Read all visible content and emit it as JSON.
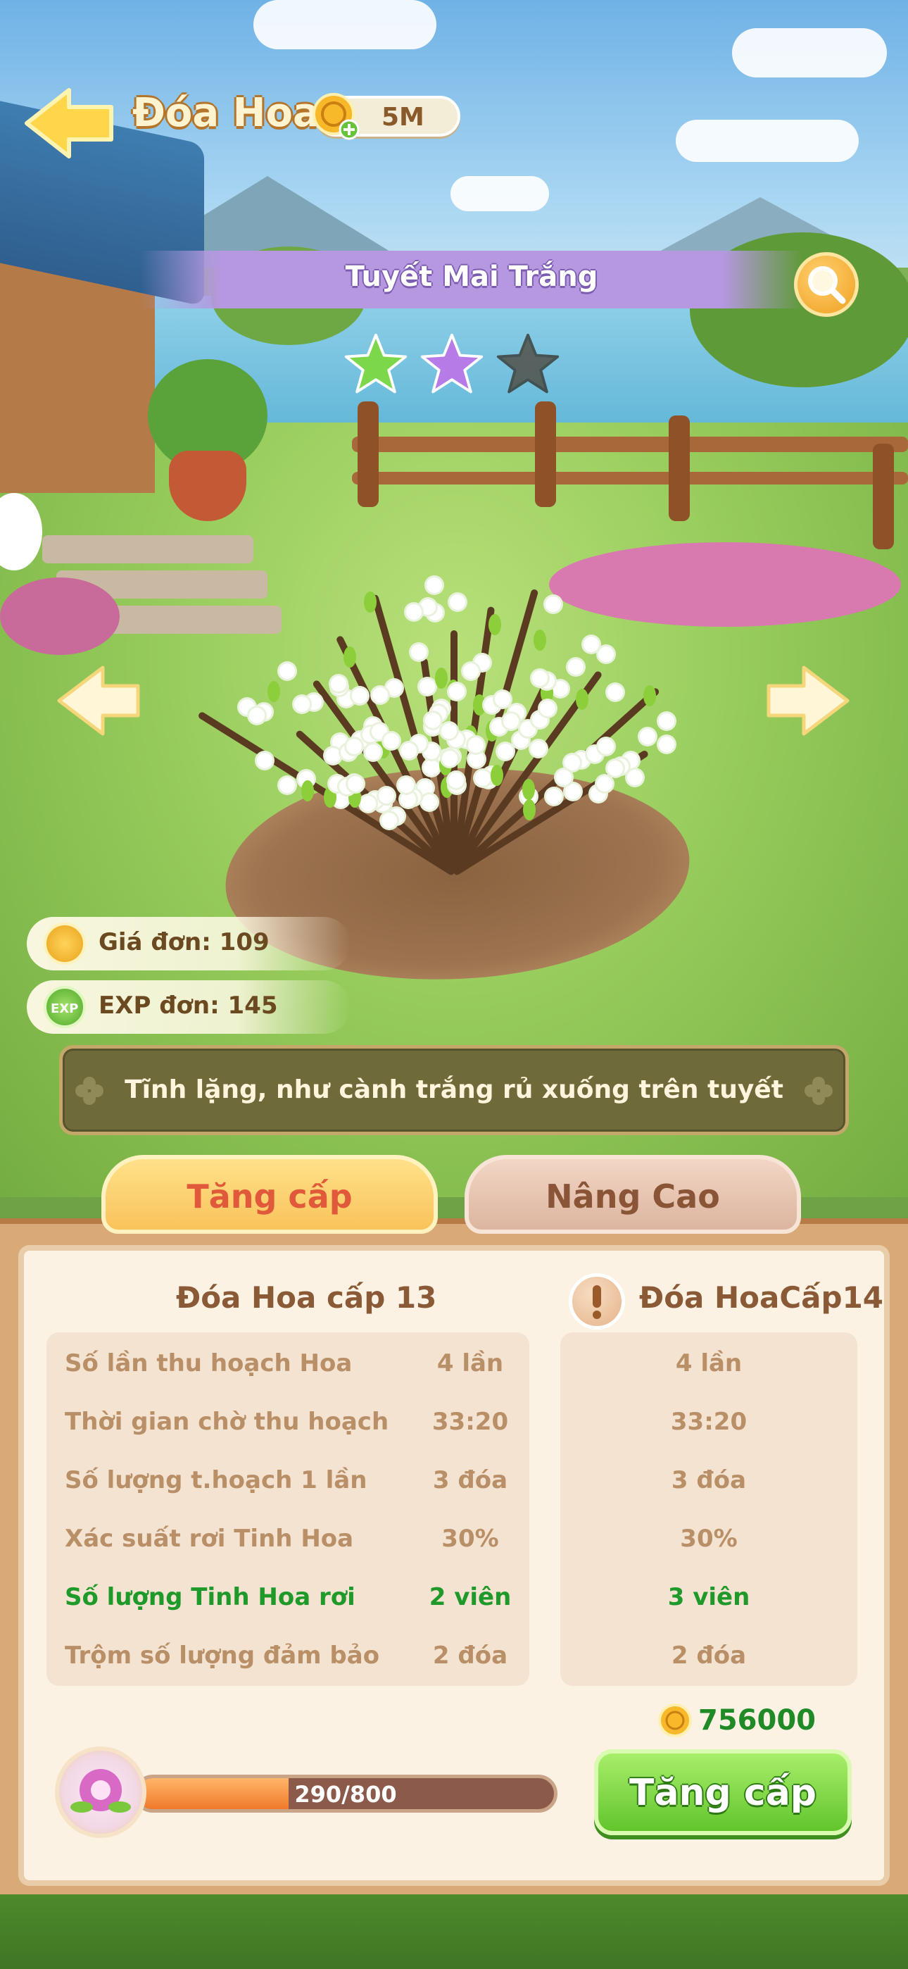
{
  "header": {
    "title": "Đóa Hoa",
    "coins": "5M"
  },
  "flower": {
    "name": "Tuyết Mai Trắng",
    "stars_filled": 2,
    "stars_total": 3,
    "star_colors": [
      "#7cd84a",
      "#b77be8",
      "#4a3a2a"
    ],
    "description": "Tĩnh lặng, như cành trắng rủ xuống trên tuyết"
  },
  "stats": {
    "price": "Giá đơn: 109",
    "exp": "EXP đơn: 145",
    "exp_icon": "EXP"
  },
  "tabs": {
    "upgrade": "Tăng cấp",
    "advanced": "Nâng Cao"
  },
  "comparison": {
    "current_title": "Đóa Hoa cấp 13",
    "next_title": "Đóa HoaCấp14",
    "rows": [
      {
        "label": "Số lần thu hoạch Hoa",
        "current": "4  lần",
        "next": "4 lần",
        "highlight": false
      },
      {
        "label": "Thời gian chờ thu hoạch",
        "current": "33:20",
        "next": "33:20",
        "highlight": false
      },
      {
        "label": "Số lượng t.hoạch 1 lần",
        "current": "3  đóa",
        "next": "3  đóa",
        "highlight": false
      },
      {
        "label": "Xác suất rơi Tinh Hoa",
        "current": "30%",
        "next": "30%",
        "highlight": false
      },
      {
        "label": "Số lượng Tinh Hoa rơi",
        "current": "2  viên",
        "next": "3  viên",
        "highlight": true
      },
      {
        "label": "Trộm số lượng đảm bảo",
        "current": "2  đóa",
        "next": "2  đóa",
        "highlight": false
      }
    ]
  },
  "upgrade": {
    "cost": "756000",
    "progress_text": "290/800",
    "progress_fraction": 0.3625,
    "button_label": "Tăng cấp"
  },
  "colors": {
    "accent_green": "#1f9a2a",
    "tab_active": "#e0593a",
    "tab_inactive": "#8a5436"
  }
}
